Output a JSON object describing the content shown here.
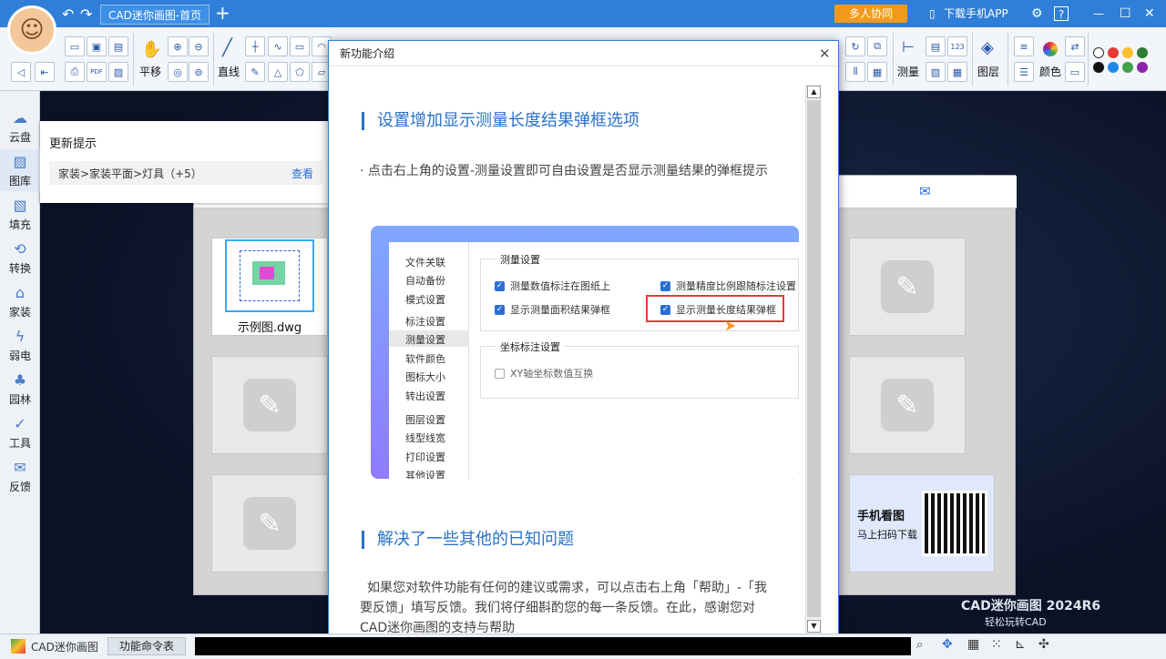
{
  "titlebar": {
    "tab_title": "CAD迷你画图-首页",
    "add_tab": "+",
    "collab": "多人协同",
    "download_app": "下载手机APP",
    "settings_icon": "gear-icon",
    "help": "?",
    "minimize": "—",
    "maximize": "☐",
    "close": "✕"
  },
  "toolbar": {
    "pan_label": "平移",
    "line_label": "直线",
    "measure_label": "测量",
    "layer_label": "图层",
    "color_label": "颜色",
    "palette": [
      "#ffffff",
      "#e53935",
      "#fbc02d",
      "#2e7d32",
      "#111111",
      "#1e88e5",
      "#43a047",
      "#8e24aa"
    ]
  },
  "sidebar": {
    "items": [
      {
        "label": "云盘",
        "icon": "cloud-icon"
      },
      {
        "label": "图库",
        "icon": "gallery-icon"
      },
      {
        "label": "填充",
        "icon": "fill-icon"
      },
      {
        "label": "转换",
        "icon": "convert-icon"
      },
      {
        "label": "家装",
        "icon": "home-icon"
      },
      {
        "label": "弱电",
        "icon": "power-icon"
      },
      {
        "label": "园林",
        "icon": "tree-icon"
      },
      {
        "label": "工具",
        "icon": "tool-icon"
      },
      {
        "label": "反馈",
        "icon": "mail-icon"
      }
    ]
  },
  "update": {
    "title": "更新提示",
    "text": "家装>家装平面>灯具（+5）",
    "view": "查看"
  },
  "home": {
    "sample_name": "示例图.dwg",
    "promo_title": "手机看图",
    "promo_sub": "马上扫码下载",
    "brand": "CAD迷你画图 2024R6",
    "slogan": "轻松玩转CAD"
  },
  "modal": {
    "title": "新功能介绍",
    "close": "✕",
    "heading1": "设置增加显示测量长度结果弹框选项",
    "para1": "·  点击右上角的设置-测量设置即可自由设置是否显示测量结果的弹框提示",
    "heading2": "解决了一些其他的已知问题",
    "para2": "如果您对软件功能有任何的建议或需求，可以点击右上角「帮助」-「我要反馈」填写反馈。我们将仔细斟酌您的每一条反馈。在此，感谢您对CAD迷你画图的支持与帮助"
  },
  "settings_img": {
    "menu": [
      "文件关联",
      "自动备份",
      "模式设置",
      "标注设置",
      "测量设置",
      "软件颜色",
      "图标大小",
      "转出设置",
      "图层设置",
      "线型线宽",
      "打印设置",
      "其他设置"
    ],
    "group1": "测量设置",
    "cb1": "测量数值标注在图纸上",
    "cb2": "测量精度比例跟随标注设置",
    "cb3": "显示测量面积结果弹框",
    "cb4": "显示测量长度结果弹框",
    "group2": "坐标标注设置",
    "cb5": "XY轴坐标数值互换"
  },
  "status": {
    "app_name": "CAD迷你画图",
    "cmd_table": "功能命令表"
  }
}
